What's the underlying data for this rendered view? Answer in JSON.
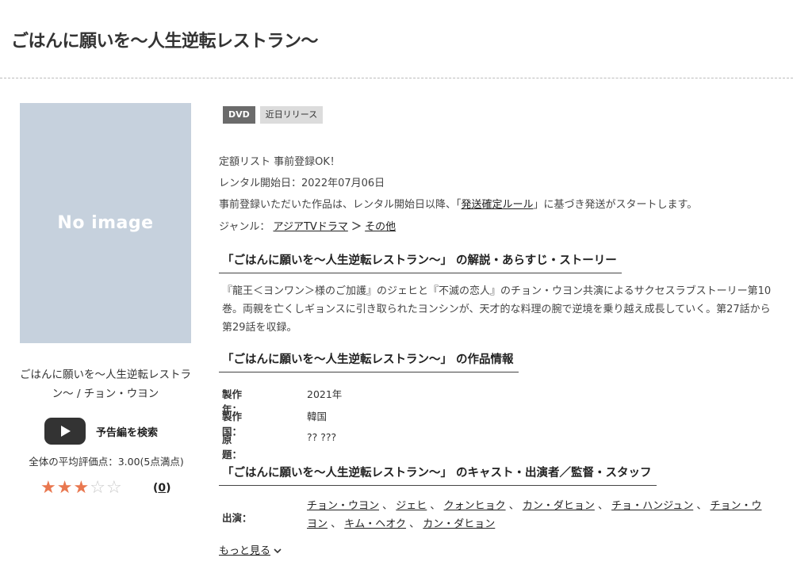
{
  "title": "ごはんに願いを〜人生逆転レストラン〜",
  "no_image_text": "No image",
  "left": {
    "title_line": "ごはんに願いを〜人生逆転レストラン〜 / チョン・ウヨン",
    "trailer_label": "予告編を検索",
    "average_text": "全体の平均評価点：3.00(5点満点)",
    "rating": 3,
    "rating_max": 5,
    "review_count": "0"
  },
  "badges": {
    "dvd": "DVD",
    "new": "近日リリース"
  },
  "info": {
    "list_text": "定額リスト 事前登録OK！",
    "rental_start": "レンタル開始日：2022年07月06日",
    "notice_prefix": "事前登録いただいた作品は、レンタル開始日以降、「",
    "notice_link": "発送確定ルール",
    "notice_suffix": "」に基づき発送がスタートします。",
    "genre_label": "ジャンル：",
    "genre_1": "アジアTVドラマ",
    "genre_sep": "＞",
    "genre_2": "その他"
  },
  "sections": {
    "story_heading": "「ごはんに願いを〜人生逆転レストラン〜」 の解説・あらすじ・ストーリー",
    "story_text": "『龍王＜ヨンワン＞様のご加護』のジェヒと『不滅の恋人』のチョン・ウヨン共演によるサクセスラブストーリー第10巻。両親を亡くしギョンスに引き取られたヨンシンが、天才的な料理の腕で逆境を乗り越え成長していく。第27話から第29話を収録。",
    "info_heading": "「ごはんに願いを〜人生逆転レストラン〜」 の作品情報",
    "cast_heading": "「ごはんに願いを〜人生逆転レストラン〜」 のキャスト・出演者／監督・スタッフ"
  },
  "specs": [
    {
      "label": "製作年：",
      "value": "2021年"
    },
    {
      "label": "製作国：",
      "value": "韓国"
    },
    {
      "label": "原題：",
      "value": "?? ???"
    }
  ],
  "cast": {
    "label": "出演：",
    "names": [
      "チョン・ウヨン",
      "ジェヒ",
      "クォンヒョク",
      "カン・ダヒョン",
      "チョ・ハンジュン",
      "チョン・ウヨン",
      "キム・ヘオク",
      "カン・ダヒョン"
    ],
    "separator": "、"
  },
  "more_label": "もっと見る",
  "colors": {
    "star_on": "#e9774f",
    "star_off": "#c9c9c9",
    "placeholder_bg": "#c6d1dd",
    "badge_dvd": "#6b6b6b",
    "badge_new": "#dcdcdc"
  }
}
